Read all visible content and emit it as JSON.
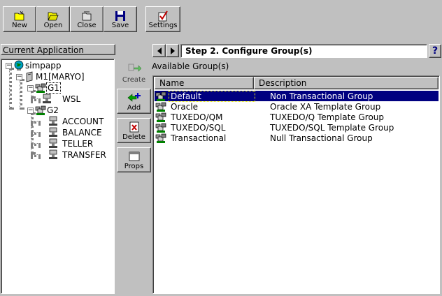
{
  "toolbar": {
    "buttons": [
      {
        "label": "New",
        "icon": "new-folder-icon"
      },
      {
        "label": "Open",
        "icon": "open-folder-icon"
      },
      {
        "label": "Close",
        "icon": "close-folder-icon"
      },
      {
        "label": "Save",
        "icon": "floppy-disk-icon"
      }
    ],
    "settings": {
      "label": "Settings",
      "icon": "checklist-icon"
    }
  },
  "left_panel": {
    "title": "Current Application",
    "tree": {
      "root": "simpapp",
      "machine": "M1[MARYO]",
      "g1": "G1",
      "wsl": "WSL",
      "g2": "G2",
      "services": [
        "ACCOUNT",
        "BALANCE",
        "TELLER",
        "TRANSFER"
      ]
    }
  },
  "actions": {
    "create": "Create",
    "add": "Add",
    "delete": "Delete",
    "props": "Props"
  },
  "header": {
    "step_title": "Step 2. Configure Group(s)",
    "help": "?"
  },
  "groups_panel": {
    "title": "Available Group(s)",
    "columns": [
      "Name",
      "Description"
    ],
    "rows": [
      {
        "name": "Default",
        "description": "Non Transactional Group"
      },
      {
        "name": "Oracle",
        "description": "Oracle XA Template Group"
      },
      {
        "name": "TUXEDO/QM",
        "description": "TUXEDO/Q Template Group"
      },
      {
        "name": "TUXEDO/SQL",
        "description": "TUXEDO/SQL Template Group"
      },
      {
        "name": "Transactional",
        "description": "Null Transactional Group"
      }
    ]
  },
  "colors": {
    "selection": "#000080",
    "background": "#c0c0c0"
  }
}
